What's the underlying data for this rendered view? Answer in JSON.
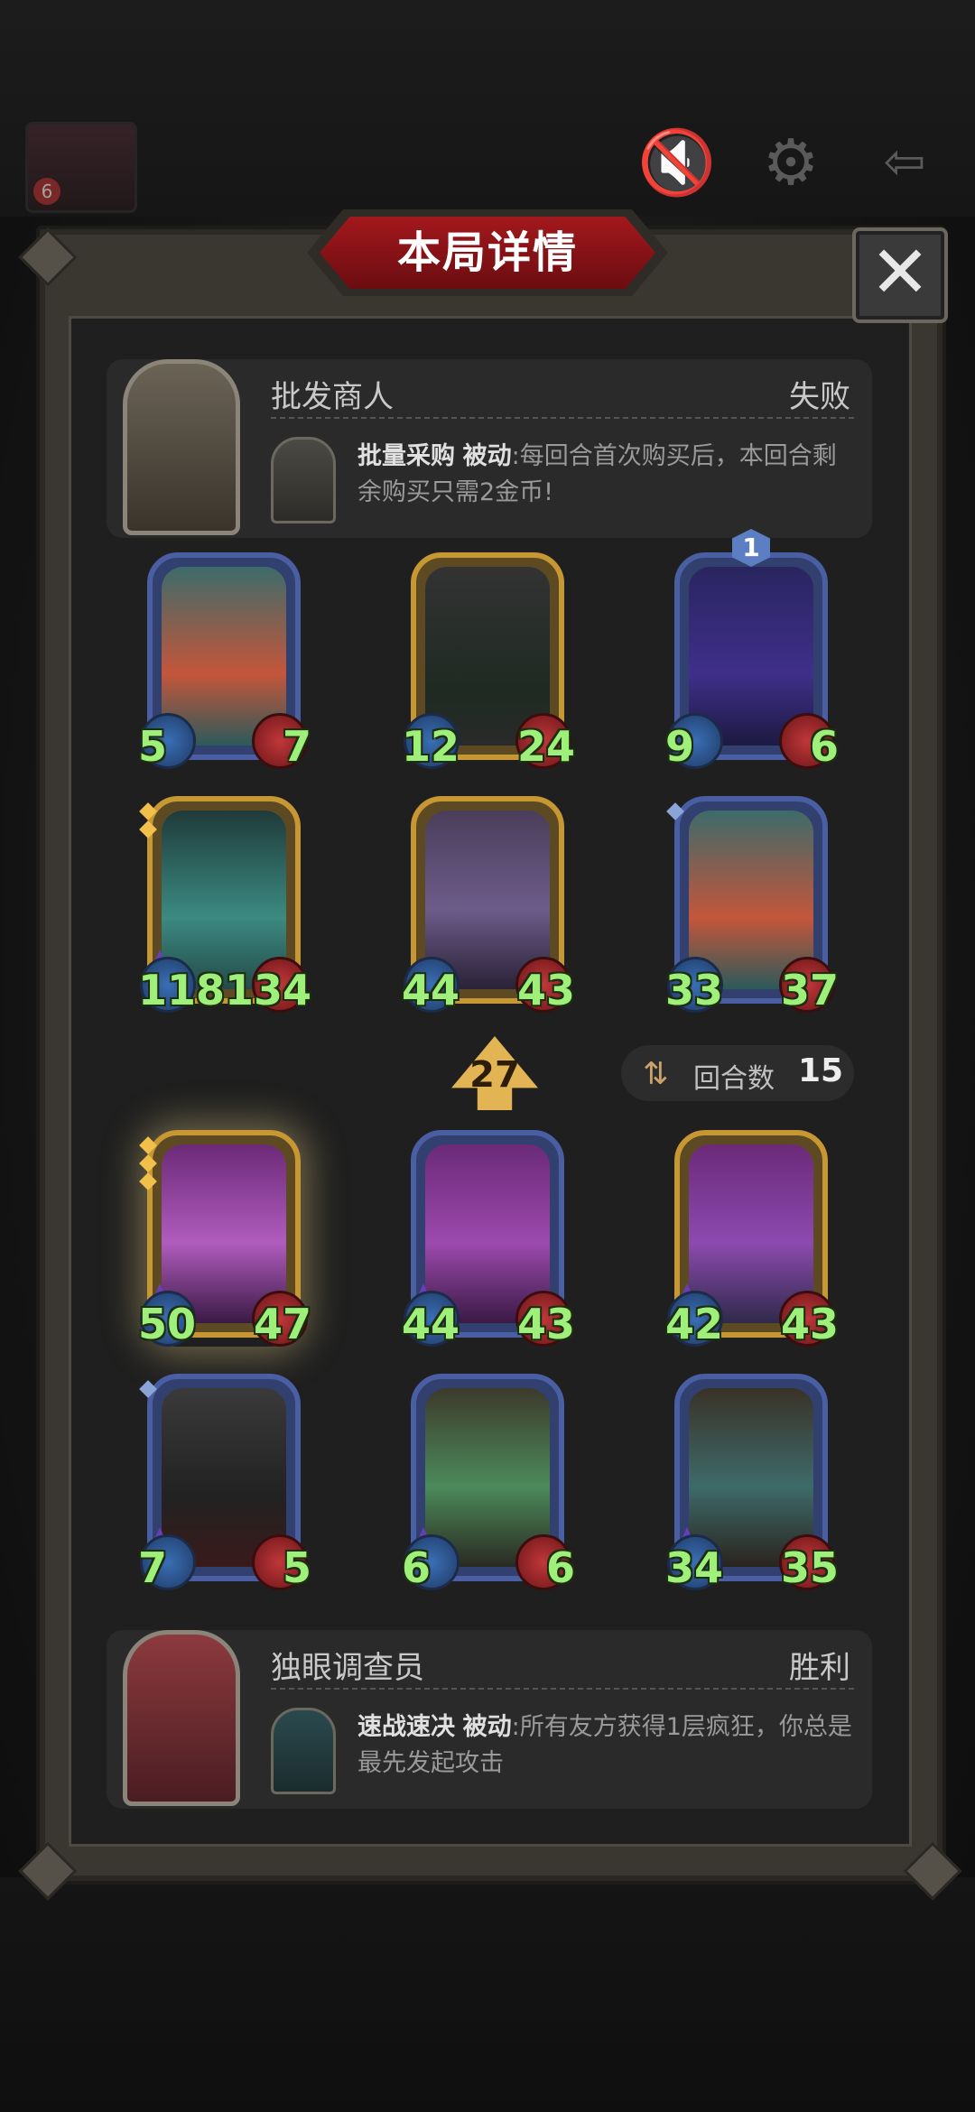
{
  "top_bar": {
    "avatar_badge": "6"
  },
  "panel": {
    "title": "本局详情",
    "close_label": "✕"
  },
  "players": {
    "top": {
      "name": "批发商人",
      "result": "失败",
      "skill_name": "批量采购",
      "skill_type": "被动",
      "skill_desc": ":每回合首次购买后，本回合剩余购买只需2金币!"
    },
    "bottom": {
      "name": "独眼调查员",
      "result": "胜利",
      "skill_name": "速战速决",
      "skill_type": "被动",
      "skill_desc": ":所有友方获得1层疯狂，你总是最先发起攻击"
    }
  },
  "cards_top": [
    {
      "atk": "5",
      "hp": "7"
    },
    {
      "atk": "12",
      "hp": "24"
    },
    {
      "atk": "9",
      "hp": "6",
      "level": "1"
    },
    {
      "atk": "118",
      "hp": "134"
    },
    {
      "atk": "44",
      "hp": "43"
    },
    {
      "atk": "33",
      "hp": "37"
    }
  ],
  "cards_bottom": [
    {
      "atk": "50",
      "hp": "47"
    },
    {
      "atk": "44",
      "hp": "43"
    },
    {
      "atk": "42",
      "hp": "43"
    },
    {
      "atk": "7",
      "hp": "5"
    },
    {
      "atk": "6",
      "hp": "6"
    },
    {
      "atk": "34",
      "hp": "35"
    }
  ],
  "turn_badge": "27",
  "rounds": {
    "label": "回合数",
    "value": "15"
  },
  "colors": {
    "title_red": "#a3181c",
    "stat_green": "#9ff07a",
    "gold_frame": "#c79733",
    "blue_frame": "#4a5fa3"
  }
}
